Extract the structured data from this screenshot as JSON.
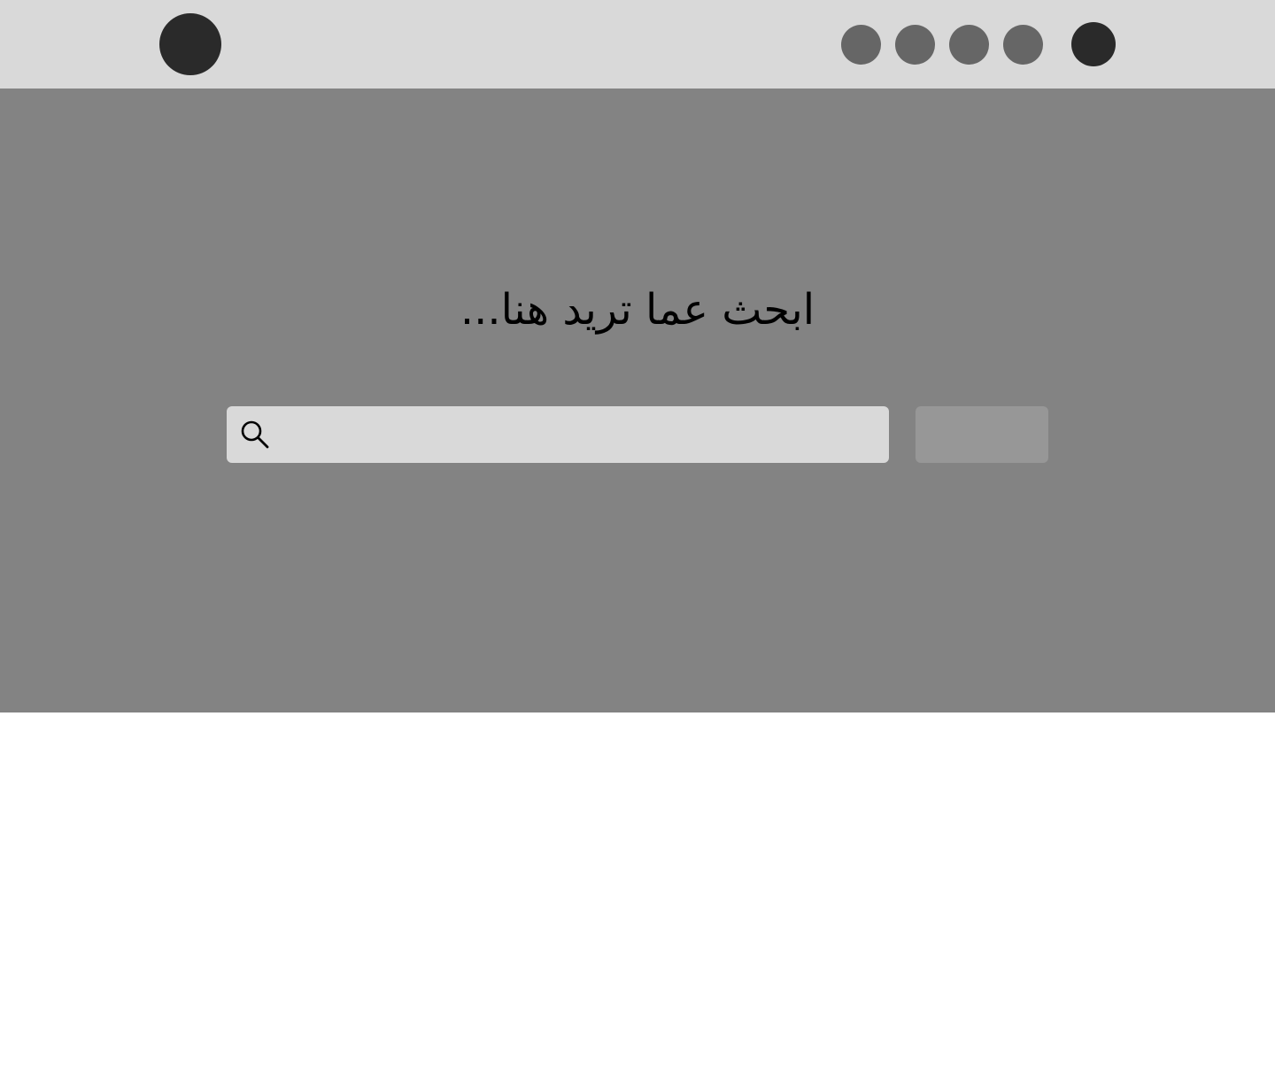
{
  "colors": {
    "topbar_bg": "#d9d9d9",
    "logo": "#2a2a2a",
    "nav_dot": "#666666",
    "avatar": "#2a2a2a",
    "hero_bg": "#838383",
    "search_box_bg": "#d9d9d9",
    "search_button_bg": "#979797",
    "content_bg": "#ffffff"
  },
  "header": {
    "logo_icon": "logo-circle",
    "nav_icons": [
      "nav-item-icon",
      "nav-item-icon",
      "nav-item-icon",
      "nav-item-icon"
    ],
    "avatar_icon": "user-avatar"
  },
  "hero": {
    "title": "ابحث عما تريد هنا...",
    "search": {
      "icon": "search-icon",
      "value": "",
      "placeholder": ""
    },
    "search_button_label": ""
  }
}
